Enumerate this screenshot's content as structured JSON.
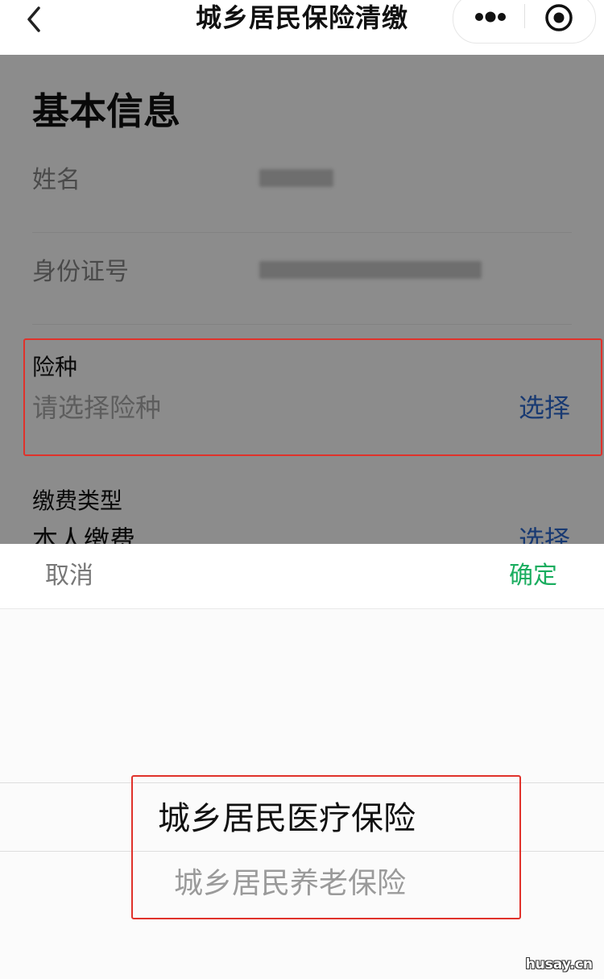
{
  "navbar": {
    "title": "城乡居民保险清缴"
  },
  "icons": {
    "back": "chevron-left-icon",
    "more": "more-dots-icon",
    "close": "target-circle-icon"
  },
  "form": {
    "section_title": "基本信息",
    "name_label": "姓名",
    "id_label": "身份证号",
    "insurance_type": {
      "label": "险种",
      "placeholder": "请选择险种",
      "action": "选择"
    },
    "payment_type": {
      "label": "缴费类型",
      "value": "本人缴费",
      "action": "选择"
    }
  },
  "picker": {
    "cancel": "取消",
    "confirm": "确定",
    "options": [
      "城乡居民医疗保险",
      "城乡居民养老保险"
    ],
    "selected_index": 0
  },
  "colors": {
    "highlight": "#e0322b",
    "confirm": "#1aad5f",
    "link": "#2f6ad0"
  },
  "watermark": "husay.cn"
}
